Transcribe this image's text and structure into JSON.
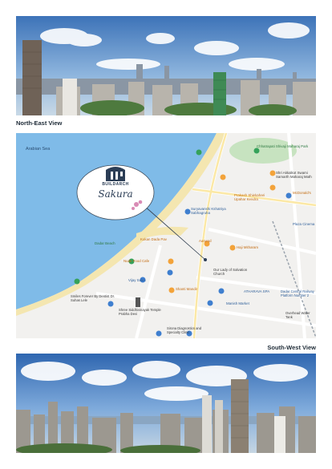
{
  "captions": {
    "top": "North-East View",
    "bottom": "South-West View"
  },
  "brand": {
    "name": "BUILDARCH",
    "project": "Sakura"
  },
  "map": {
    "sea_label": "Arabian Sea",
    "labels": [
      "Chhatrapati Shivaji Maharaj Park",
      "Shri Akkalkot Swami Samarth Maharaj Math",
      "Prakash Shiekahari Upahar Kendra",
      "McDonald's",
      "Plaza Cinema",
      "Suryavanshi Kshatriya Sabhagruha",
      "Dadar Beach",
      "Aaswad",
      "Kokan Dada Pav",
      "Nude Food Cafe",
      "Haji Mitharam",
      "Our Lady of Salvation Church",
      "Shanti Mandir",
      "Vijay Sales",
      "ATHARAVA SPA",
      "Manish Market",
      "Smiles Forever By Dentist Dr. Suhas Lele",
      "Shree Siddhivinayak Temple Prabha Devi",
      "Dadar Central Railway Platform Number 2",
      "Sirona Diagnostics and Specialty Clinic",
      "Overhead Water Tank"
    ]
  },
  "colors": {
    "sea": "#7fbbe8",
    "beach": "#f4e6b0",
    "land": "#f2f1ef",
    "park": "#c7e3c0",
    "accent_orange": "#f3a33a",
    "accent_blue": "#3f7fcf",
    "accent_green": "#35a25a"
  }
}
